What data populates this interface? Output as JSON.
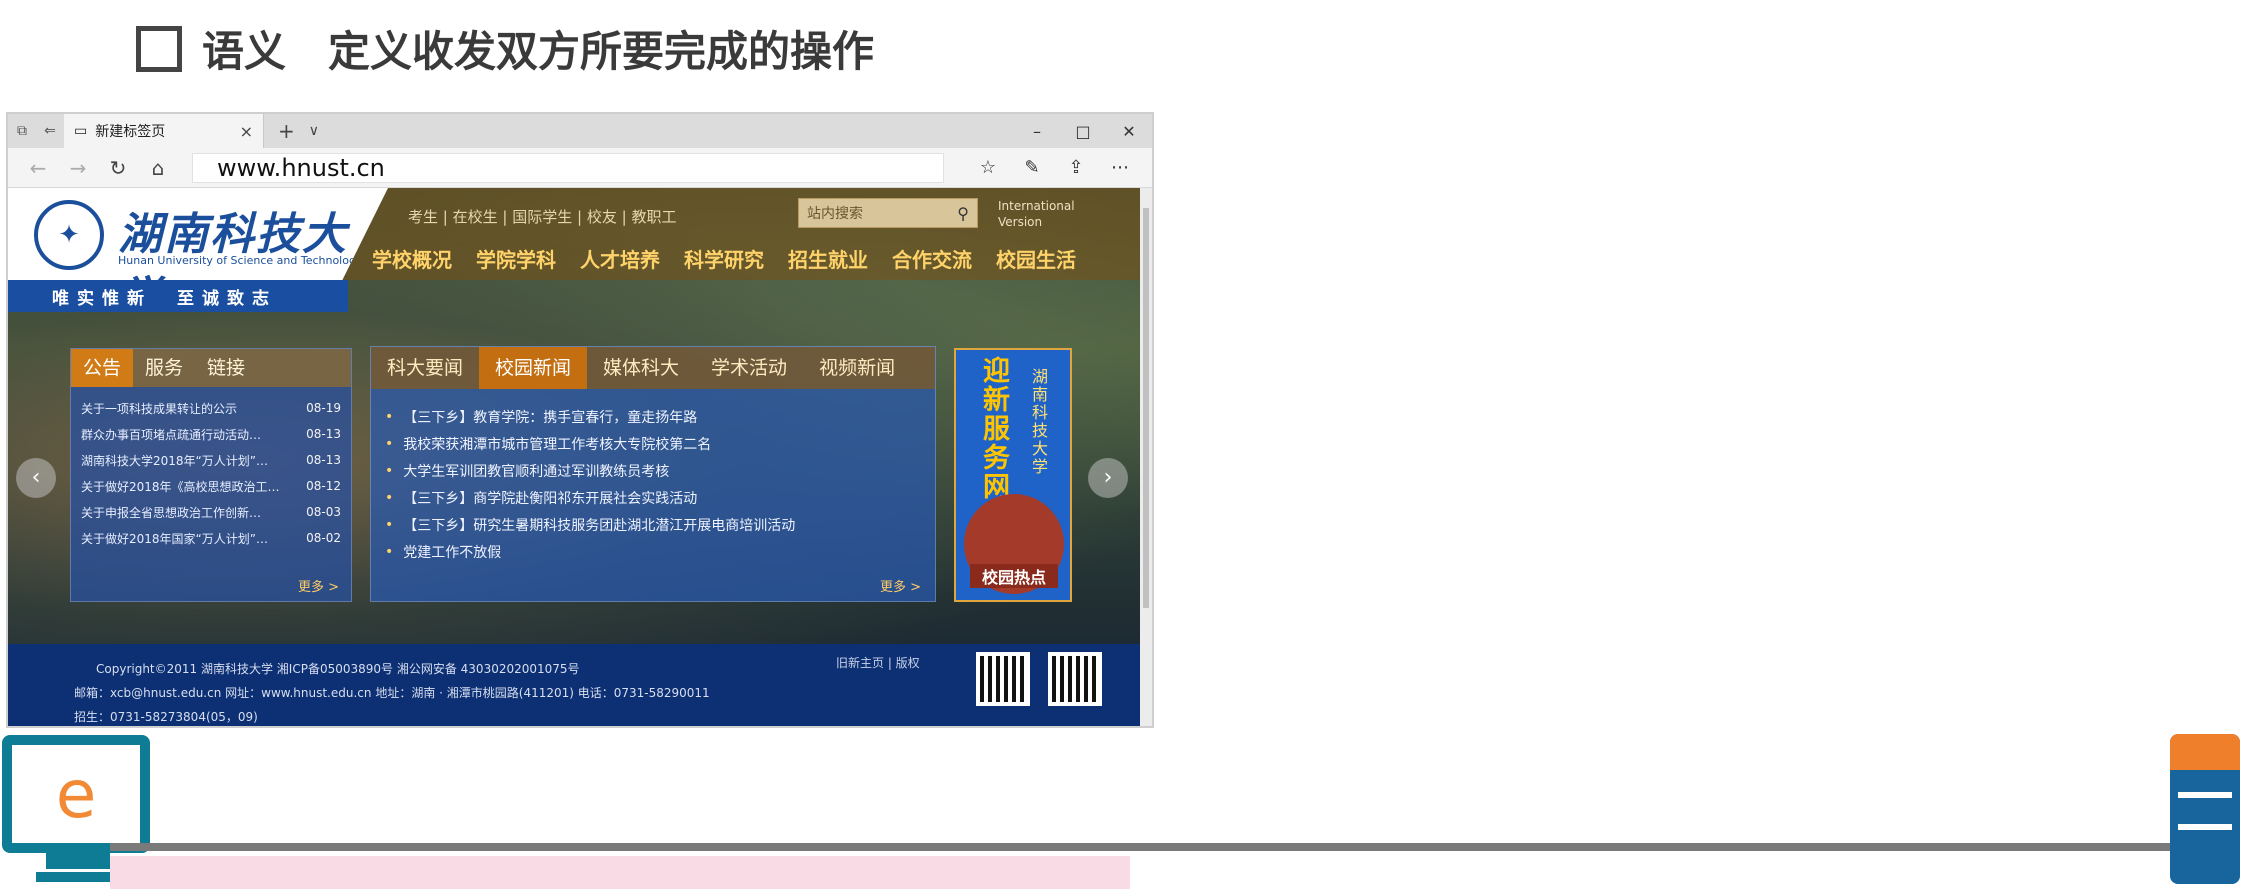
{
  "slide": {
    "title_term": "语义",
    "title_desc": "定义收发双方所要完成的操作"
  },
  "browser": {
    "tab_label": "新建标签页",
    "address": "www.hnust.cn"
  },
  "site": {
    "logo_cn": "湖南科技大学",
    "logo_en": "Hunan University of Science and Technology",
    "motto": "唯实惟新　至诚致志",
    "top_links": [
      "考生",
      "在校生",
      "国际学生",
      "校友",
      "教职工"
    ],
    "search_placeholder": "站内搜索",
    "intl_line1": "International",
    "intl_line2": "Version",
    "nav": [
      "学校概况",
      "学院学科",
      "人才培养",
      "科学研究",
      "招生就业",
      "合作交流",
      "校园生活"
    ],
    "left_tabs": [
      "公告",
      "服务",
      "链接"
    ],
    "left_items": [
      {
        "title": "关于一项科技成果转让的公示",
        "date": "08-19"
      },
      {
        "title": "群众办事百项堵点疏通行动活动…",
        "date": "08-13"
      },
      {
        "title": "湖南科技大学2018年“万人计划”…",
        "date": "08-13"
      },
      {
        "title": "关于做好2018年《高校思想政治工…",
        "date": "08-12"
      },
      {
        "title": "关于申报全省思想政治工作创新…",
        "date": "08-03"
      },
      {
        "title": "关于做好2018年国家“万人计划”…",
        "date": "08-02"
      }
    ],
    "left_more": "更多 >",
    "mid_tabs": [
      "科大要闻",
      "校园新闻",
      "媒体科大",
      "学术活动",
      "视频新闻"
    ],
    "mid_items": [
      "【三下乡】教育学院：携手宣春行，童走扬年路",
      "我校荣获湘潭市城市管理工作考核大专院校第二名",
      "大学生军训团教官顺利通过军训教练员考核",
      "【三下乡】商学院赴衡阳祁东开展社会实践活动",
      "【三下乡】研究生暑期科技服务团赴湖北潜江开展电商培训活动",
      "党建工作不放假"
    ],
    "mid_more": "更多 >",
    "banner_main": "迎新服务网",
    "banner_side": "湖南科技大学",
    "banner_hot": "校园热点",
    "footer_line1": "Copyright©2011  湖南科技大学  湘ICP备05003890号  湘公网安备 43030202001075号",
    "footer_line2": "邮箱：xcb@hnust.edu.cn  网址：www.hnust.edu.cn  地址：湖南 · 湘潭市桃园路(411201)  电话：0731-58290011",
    "footer_line3": "招生：0731-58273804(05，09)",
    "footer_links": "旧新主页 | 版权"
  },
  "diagram": {
    "client_letter": "e"
  }
}
